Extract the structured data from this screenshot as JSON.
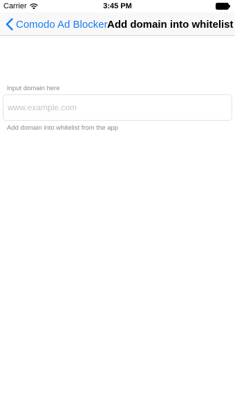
{
  "status_bar": {
    "carrier": "Carrier",
    "time": "3:45 PM"
  },
  "nav": {
    "back_label": "Comodo Ad Blocker",
    "title": "Add domain into whitelist"
  },
  "form": {
    "input_label": "Input domain here",
    "input_value": "",
    "input_placeholder": "www.example.com",
    "hint": "Add domain into whitelist from the app"
  },
  "colors": {
    "accent": "#1a7cf5",
    "nav_background": "#f8f8f8",
    "secondary_text": "#8a8a8a"
  },
  "icons": {
    "wifi": "wifi-icon",
    "battery": "battery-icon",
    "back": "chevron-left-icon"
  }
}
